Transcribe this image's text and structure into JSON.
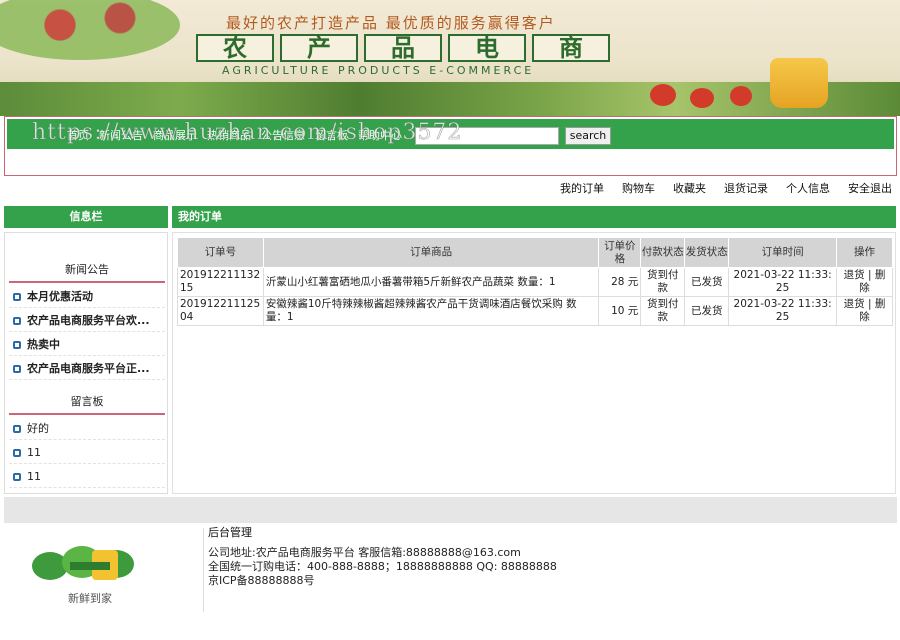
{
  "banner": {
    "slogan": "最好的农产打造产品   最优质的服务赢得客户",
    "title_chars": [
      "农",
      "产",
      "品",
      "电",
      "商"
    ],
    "subtitle": "AGRICULTURE PRODUCTS E-COMMERCE"
  },
  "nav": {
    "links": [
      "首页",
      "新闻公告",
      "商品展示",
      "热销商品",
      "公告信息",
      "留言板",
      "帮助中心"
    ],
    "search_button": "search",
    "accent": "#34a14b"
  },
  "watermark": "https://www.huzhan.com/ishop3572",
  "user_links": [
    "我的订单",
    "购物车",
    "收藏夹",
    "退货记录",
    "个人信息",
    "安全退出"
  ],
  "sidebar": {
    "header": "信息栏",
    "news_title": "新闻公告",
    "news_items": [
      "本月优惠活动",
      "农产品电商服务平台欢...",
      "热卖中",
      "农产品电商服务平台正..."
    ],
    "board_title": "留言板",
    "board_items": [
      "好的",
      "11",
      "11"
    ]
  },
  "main": {
    "header": "我的订单",
    "columns": [
      "订单号",
      "订单商品",
      "订单价格",
      "付款状态",
      "发货状态",
      "订单时间",
      "操作"
    ],
    "rows": [
      {
        "order_no": "20191221113215",
        "product": "沂蒙山小红薯富硒地瓜小番薯带箱5斤新鲜农产品蔬菜 数量：1",
        "price": "28 元",
        "pay_status": "货到付款",
        "ship_status": "已发货",
        "time": "2021-03-22 11:33:25",
        "ops": [
          "退货",
          "删除"
        ]
      },
      {
        "order_no": "20191221112504",
        "product": "安徽辣酱10斤特辣辣椒酱超辣辣酱农产品干货调味酒店餐饮采购 数量：1",
        "price": "10 元",
        "pay_status": "货到付款",
        "ship_status": "已发货",
        "time": "2021-03-22 11:33:25",
        "ops": [
          "退货",
          "删除"
        ]
      }
    ]
  },
  "footer": {
    "title": "后台管理",
    "lines": [
      "公司地址:农产品电商服务平台   客服信箱:88888888@163.com",
      "全国统一订购电话：400-888-8888；18888888888   QQ: 88888888",
      "京ICP备88888888号"
    ],
    "logo_text": "新鲜到家"
  }
}
